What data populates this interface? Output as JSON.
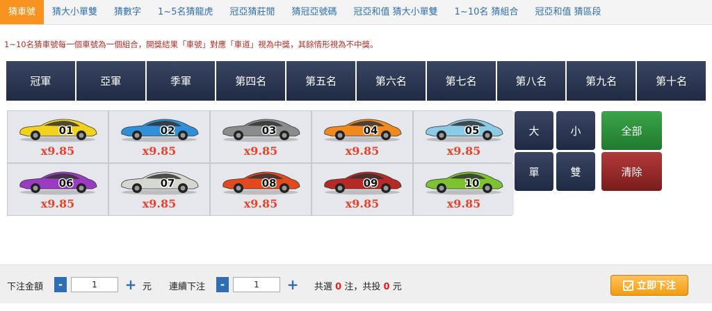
{
  "tabs": [
    {
      "label": "猜車號",
      "active": true
    },
    {
      "label": "猜大小單雙"
    },
    {
      "label": "猜數字"
    },
    {
      "label": "1~5名猜龍虎"
    },
    {
      "label": "冠亞猜莊閒"
    },
    {
      "label": "猜冠亞號碼"
    },
    {
      "label": "冠亞和值 猜大小單雙"
    },
    {
      "label": "1~10名 猜組合"
    },
    {
      "label": "冠亞和值 猜區段"
    }
  ],
  "notice": "1~10名猜車號每一個車號為一個組合，開獎結果「車號」對應「車道」視為中獎，其餘情形視為不中獎。",
  "positions": [
    "冠軍",
    "亞軍",
    "季軍",
    "第四名",
    "第五名",
    "第六名",
    "第七名",
    "第八名",
    "第九名",
    "第十名"
  ],
  "cars": [
    {
      "num": "01",
      "odds": "x9.85",
      "color": "#f2d21a"
    },
    {
      "num": "02",
      "odds": "x9.85",
      "color": "#2f8fd8"
    },
    {
      "num": "03",
      "odds": "x9.85",
      "color": "#8a8c8e"
    },
    {
      "num": "04",
      "odds": "x9.85",
      "color": "#f08a1c"
    },
    {
      "num": "05",
      "odds": "x9.85",
      "color": "#8ccbe6"
    },
    {
      "num": "06",
      "odds": "x9.85",
      "color": "#9a3bc2"
    },
    {
      "num": "07",
      "odds": "x9.85",
      "color": "#d7d7d2"
    },
    {
      "num": "08",
      "odds": "x9.85",
      "color": "#e04a1e"
    },
    {
      "num": "09",
      "odds": "x9.85",
      "color": "#b52a24"
    },
    {
      "num": "10",
      "odds": "x9.85",
      "color": "#7cc232"
    }
  ],
  "quick": {
    "big": "大",
    "small": "小",
    "odd": "單",
    "even": "雙",
    "all": "全部",
    "clear": "清除"
  },
  "bottom": {
    "amount_label": "下注金額",
    "amount_value": "1",
    "yuan": "元",
    "consecutive_label": "連續下注",
    "consecutive_value": "1",
    "selected_prefix": "共選",
    "selected_count": "0",
    "bets_suffix": "注，共投",
    "total": "0",
    "total_unit": "元",
    "minus": "-",
    "plus": "+",
    "submit": "立即下注"
  },
  "colors": {
    "accent": "#f7931e",
    "nav": "#2f3a56",
    "odds": "#e8432a",
    "green": "#2e8f3c",
    "red": "#9b2a2a"
  }
}
